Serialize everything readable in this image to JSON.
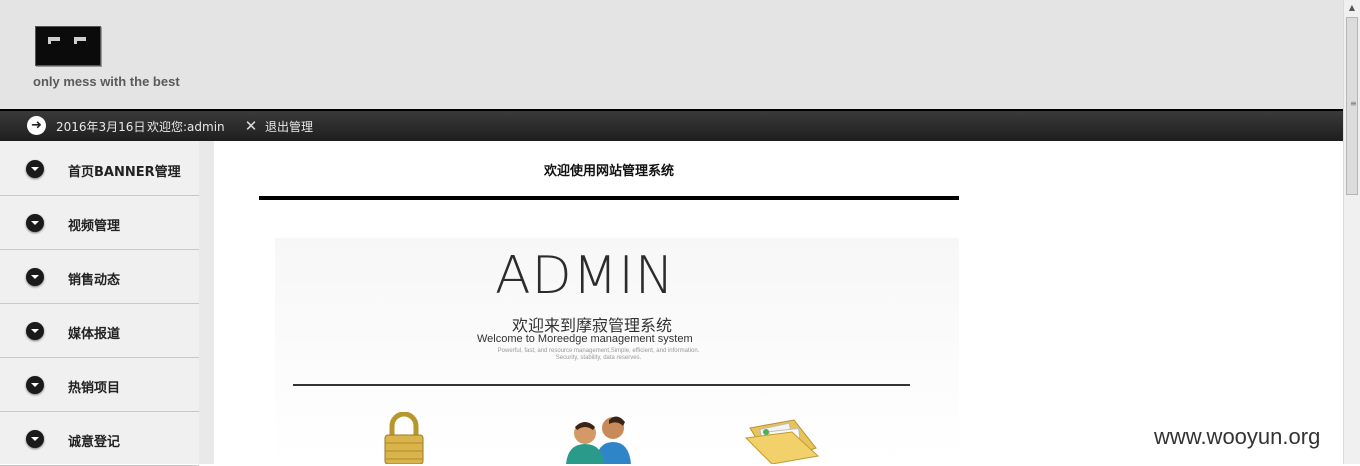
{
  "header": {
    "slogan": "only mess with the best"
  },
  "topbar": {
    "date": "2016年3月16日",
    "welcome_user": "欢迎您:admin",
    "logout": "退出管理"
  },
  "sidebar": {
    "items": [
      {
        "label": "首页BANNER管理"
      },
      {
        "label": "视频管理"
      },
      {
        "label": "销售动态"
      },
      {
        "label": "媒体报道"
      },
      {
        "label": "热销项目"
      },
      {
        "label": "诚意登记"
      }
    ]
  },
  "main": {
    "welcome_title": "欢迎使用网站管理系统",
    "banner": {
      "big_word": "ADMIN",
      "cn_title": "欢迎来到摩寂管理系统",
      "en_title": "Welcome to Moreedge management system",
      "small_line1": "Powerful, fast, and resource management,Simple, efficient, and information.",
      "small_line2": "Security, stability, data reserves."
    }
  },
  "watermark": "www.wooyun.org",
  "colors": {
    "topbar": "#1e1e1e",
    "header": "#e4e4e4",
    "sidebar": "#f0f0f0"
  },
  "icons": [
    "arrow-right-icon",
    "tools-icon",
    "chevron-down-icon",
    "lock-icon",
    "users-icon",
    "folder-icon"
  ]
}
